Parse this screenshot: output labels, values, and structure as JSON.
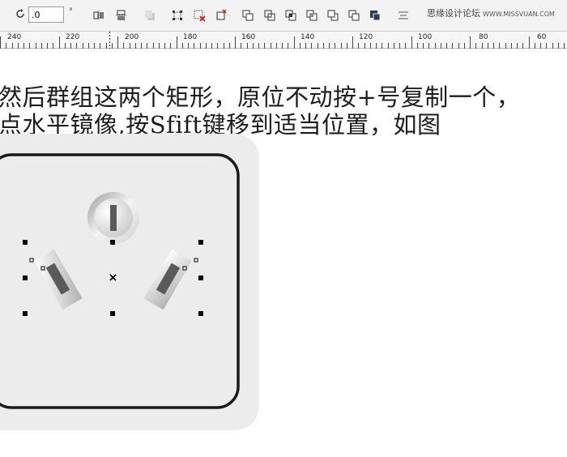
{
  "toolbar": {
    "rotation_value": ".0",
    "degree_symbol": "°",
    "icons": [
      "mirror-horizontal-icon",
      "mirror-vertical-icon",
      "shadow-object-icon",
      "distribute-icon",
      "clear-transform-icon",
      "transform-icon",
      "weld-icon",
      "trim-icon",
      "intersect-icon",
      "simplify-icon",
      "front-minus-back-icon",
      "back-minus-front-icon",
      "combine-icon",
      "align-icon"
    ],
    "watermark_text": "思缘设计论坛",
    "watermark_site": "WWW.MISSVUAN.COM"
  },
  "ruler": {
    "labels": [
      "240",
      "220",
      "200",
      "180",
      "160",
      "140",
      "120",
      "100",
      "80",
      "60"
    ]
  },
  "instructions": {
    "line1": "然后群组这两个矩形，原位不动按+号复制一个，",
    "line2": "点水平镜像,按Sfift键移到适当位置，如图"
  },
  "colors": {
    "canvas_bg": "#ffffff",
    "toolbar_bg": "#f3f3f3",
    "panel_bg": "#ececec",
    "outline": "#1a1a1a",
    "prong_dark": "#5a5a5a"
  }
}
